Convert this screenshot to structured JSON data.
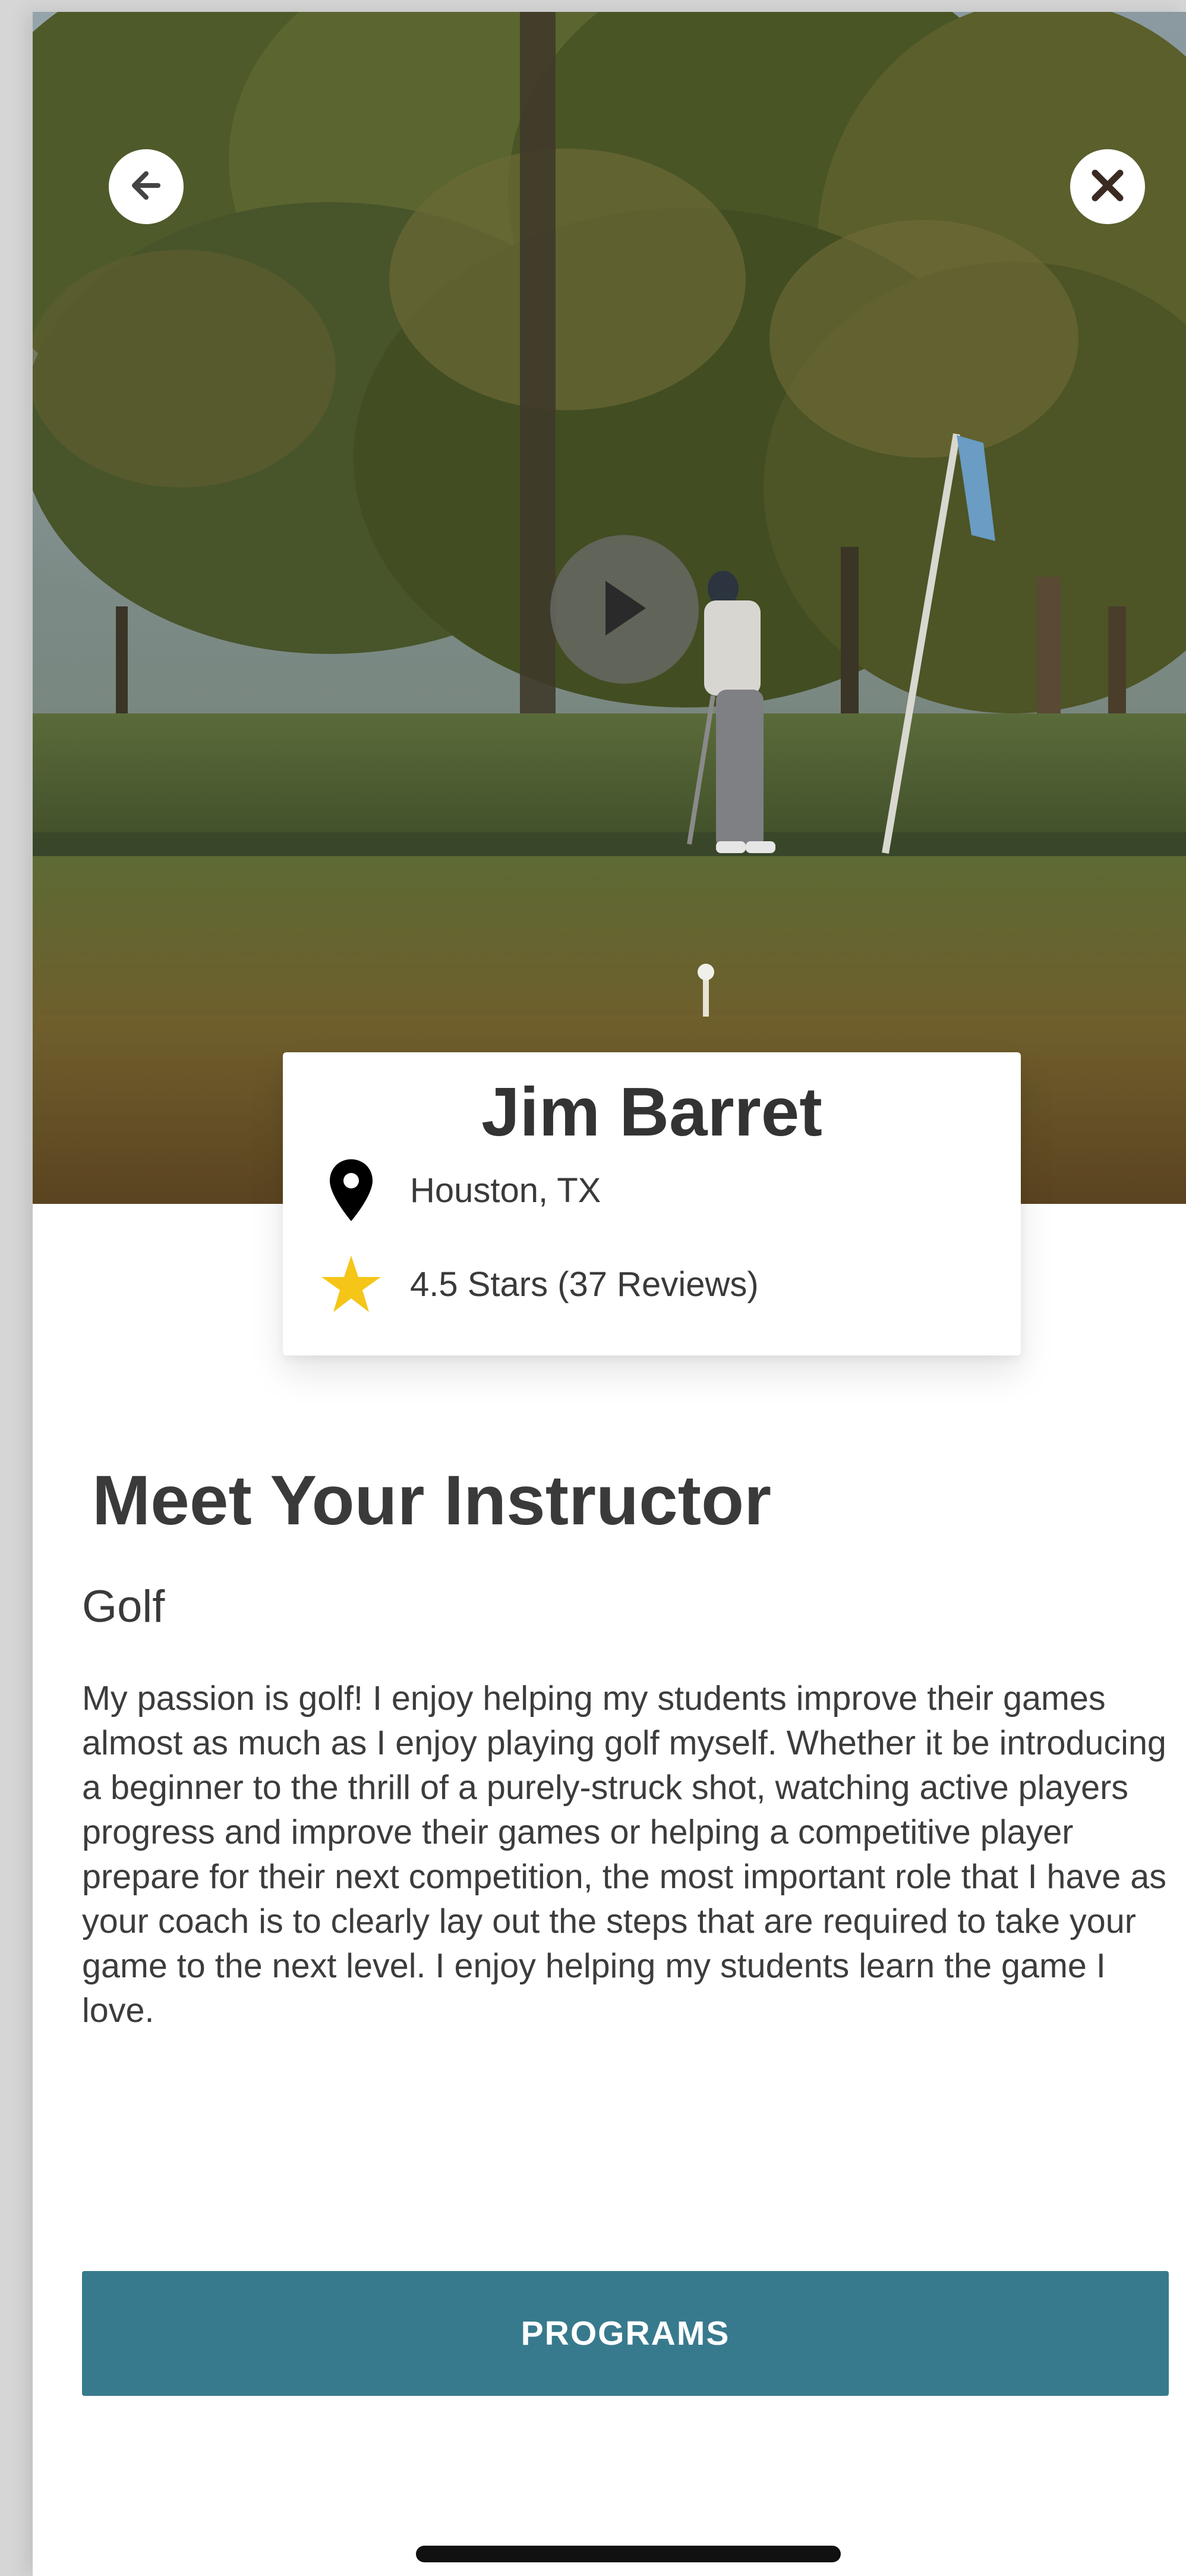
{
  "instructor": {
    "name": "Jim Barret",
    "location": "Houston, TX",
    "rating": "4.5 Stars (37 Reviews)"
  },
  "section": {
    "title": "Meet Your Instructor",
    "sport": "Golf",
    "bio": "My passion is golf! I enjoy helping my students improve their games almost as much as I enjoy playing golf myself.  Whether it be introducing a beginner to the thrill of a purely-struck shot, watching active players progress and improve their games or helping a competitive player prepare for their next competition, the most important role that I have as your coach is to clearly lay out the steps that are required to take your game to the next level. I enjoy helping my students learn the game I love."
  },
  "actions": {
    "programs_label": "PROGRAMS"
  },
  "icons": {
    "back": "arrow-left-icon",
    "close": "close-icon",
    "play": "play-icon",
    "location": "map-pin-icon",
    "rating": "star-icon"
  },
  "colors": {
    "accent": "#387a8d",
    "star": "#f5c518",
    "text": "#3a3a3a"
  }
}
